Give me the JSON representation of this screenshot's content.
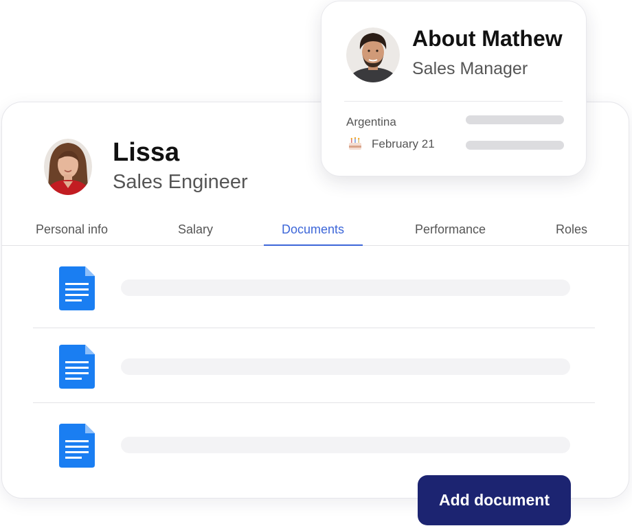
{
  "profile": {
    "name": "Lissa",
    "role": "Sales Engineer",
    "avatar": "woman-portrait-avatar"
  },
  "tabs": [
    {
      "label": "Personal info",
      "active": false
    },
    {
      "label": "Salary",
      "active": false
    },
    {
      "label": "Documents",
      "active": true
    },
    {
      "label": "Performance",
      "active": false
    },
    {
      "label": "Roles",
      "active": false
    }
  ],
  "documents": {
    "count": 3,
    "icon": "document-icon",
    "icon_color": "#1a7ef2"
  },
  "add_button": {
    "label": "Add document",
    "color": "#1c2471"
  },
  "about_card": {
    "title": "About Mathew",
    "role": "Sales Manager",
    "avatar": "man-portrait-avatar",
    "country": "Argentina",
    "birthday": "February 21",
    "birthday_icon": "birthday-cake-icon"
  },
  "colors": {
    "accent": "#3c66d8",
    "text_primary": "#111111",
    "text_secondary": "#555555"
  }
}
